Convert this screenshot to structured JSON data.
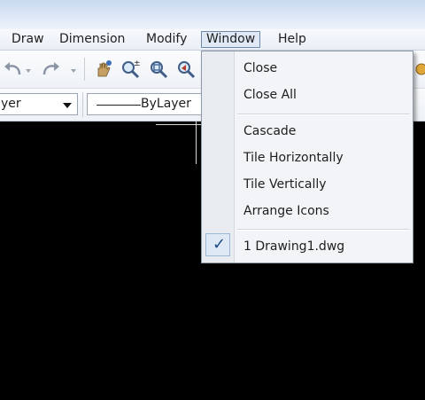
{
  "menubar": {
    "items": [
      "Draw",
      "Dimension",
      "Modify",
      "Window",
      "Help"
    ],
    "partial_left": "",
    "active": "Window"
  },
  "toolbar": {
    "layer_combo_value": "yer",
    "linetype_combo_value": "ByLayer"
  },
  "window_menu": {
    "items": [
      {
        "label": "Close"
      },
      {
        "label": "Close All"
      },
      {
        "label": "Cascade"
      },
      {
        "label": "Tile Horizontally"
      },
      {
        "label": "Tile Vertically"
      },
      {
        "label": "Arrange Icons"
      },
      {
        "label": "1 Drawing1.dwg",
        "checked": true
      }
    ]
  },
  "icons": {
    "undo": "undo-icon",
    "redo": "redo-icon",
    "pan": "pan-icon",
    "zoom_realtime": "zoom-realtime-icon",
    "zoom_window": "zoom-window-icon",
    "zoom_previous": "zoom-previous-icon",
    "check": "checkmark-icon"
  },
  "colors": {
    "drawing_background": "#000000",
    "menu_active_border": "#6f89a8",
    "check_color": "#1c4d86"
  }
}
